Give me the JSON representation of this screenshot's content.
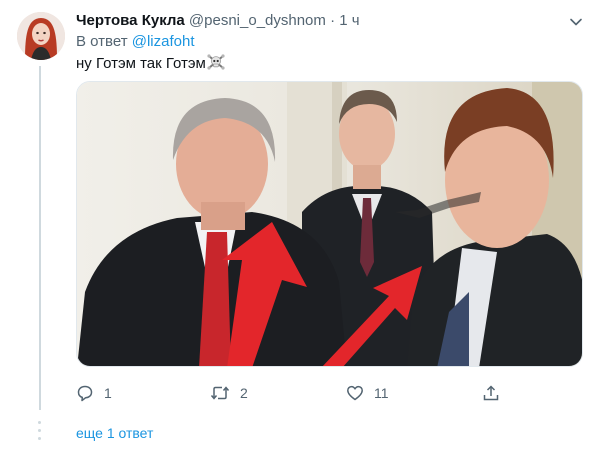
{
  "tweet": {
    "author_name": "Чертова Кукла",
    "handle": "@pesni_o_dyshnom",
    "separator": "·",
    "time": "1 ч",
    "reply_prefix": "В ответ",
    "reply_to": "@lizafoht",
    "text": "ну Готэм так Готэм"
  },
  "actions": {
    "reply_count": "1",
    "retweet_count": "2",
    "like_count": "11"
  },
  "thread": {
    "more_replies": "еще 1 ответ"
  },
  "icons": [
    "caret-down-icon",
    "skull-crossbones-icon",
    "reply-icon",
    "retweet-icon",
    "like-icon",
    "share-icon"
  ],
  "colors": {
    "link": "#1b95e0",
    "secondary_text": "#536471",
    "arrow_red": "#e3262b",
    "thread_line": "#cfd9de"
  }
}
